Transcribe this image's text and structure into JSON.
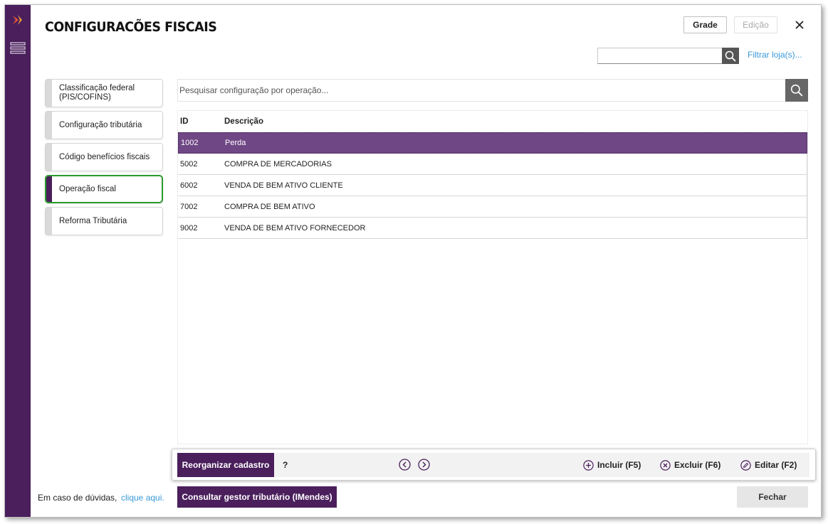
{
  "window": {
    "title": "CONFIGURACÕES FISCAIS",
    "grade_label": "Grade",
    "edicao_label": "Edição",
    "filter_stores_label": "Filtrar loja(s)..."
  },
  "nav": {
    "items": [
      {
        "label": "Classificação federal (PIS/COFINS)"
      },
      {
        "label": "Configuração tributária"
      },
      {
        "label": "Código benefícios fiscais"
      },
      {
        "label": "Operação fiscal",
        "active": true
      },
      {
        "label": "Reforma Tributária"
      }
    ]
  },
  "search": {
    "placeholder": "Pesquisar configuração por operação..."
  },
  "table": {
    "columns": [
      "ID",
      "Descrição"
    ],
    "rows": [
      {
        "id": "1002",
        "descricao": "Perda",
        "selected": true
      },
      {
        "id": "5002",
        "descricao": "COMPRA DE MERCADORIAS"
      },
      {
        "id": "6002",
        "descricao": "VENDA DE BEM ATIVO CLIENTE"
      },
      {
        "id": "7002",
        "descricao": "COMPRA DE BEM ATIVO"
      },
      {
        "id": "9002",
        "descricao": "VENDA DE BEM ATIVO FORNECEDOR"
      }
    ]
  },
  "actions": {
    "reorganize_label": "Reorganizar cadastro",
    "help_label": "?",
    "include_label": "Incluir (F5)",
    "delete_label": "Excluir (F6)",
    "edit_label": "Editar (F2)"
  },
  "footer": {
    "help_text": "Em caso de dúvidas,",
    "help_link": "clique aqui.",
    "imendes_label": "Consultar gestor tributário (IMendes)",
    "close_label": "Fechar"
  },
  "colors": {
    "brand_purple": "#4a1f5c",
    "selected_row": "#6f4785",
    "active_outline": "#2a9a2a",
    "link_blue": "#3a9ad9"
  }
}
